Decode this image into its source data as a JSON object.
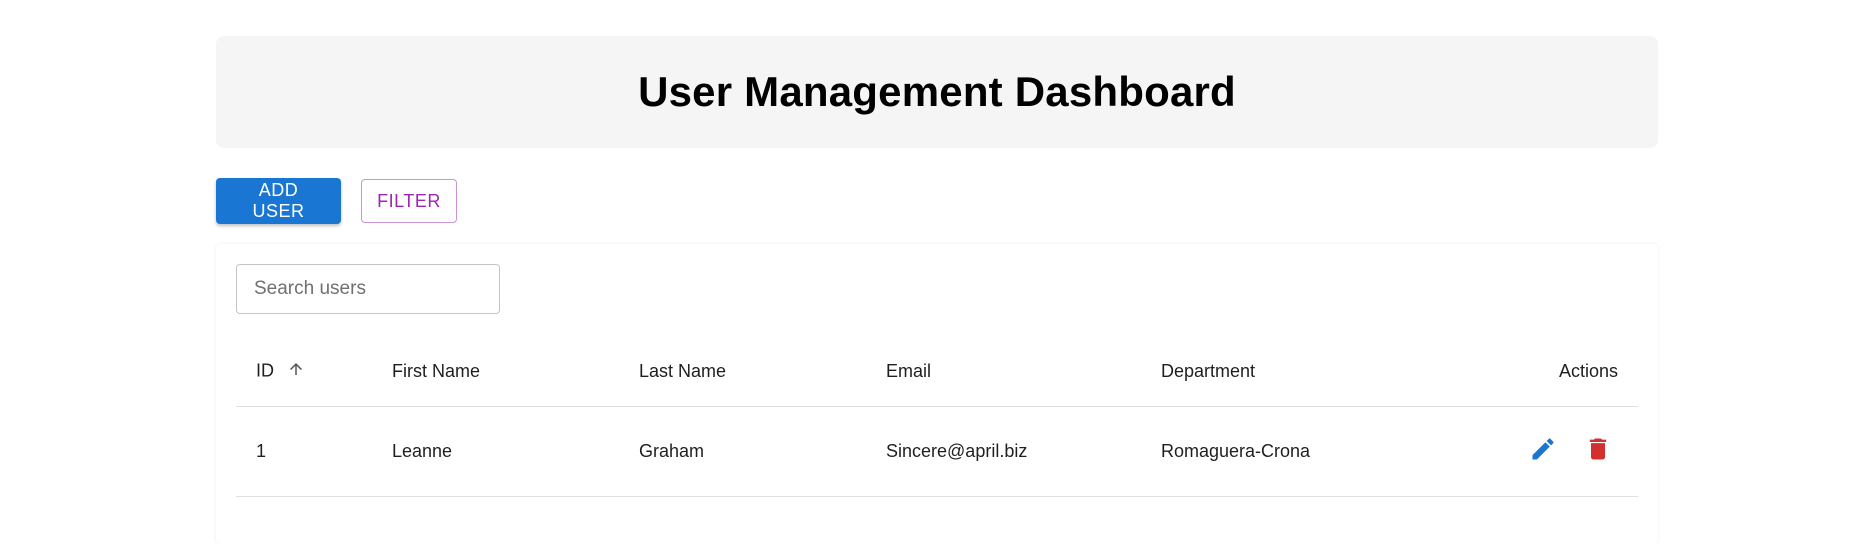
{
  "header": {
    "title": "User Management Dashboard"
  },
  "toolbar": {
    "add_user_label": "ADD USER",
    "filter_label": "FILTER"
  },
  "search": {
    "placeholder": "Search users",
    "value": ""
  },
  "table": {
    "columns": {
      "id": "ID",
      "first_name": "First Name",
      "last_name": "Last Name",
      "email": "Email",
      "department": "Department",
      "actions": "Actions"
    },
    "sort": {
      "column": "ID",
      "direction": "ascending",
      "icon": "arrow-up-icon"
    },
    "rows": [
      {
        "id": "1",
        "first_name": "Leanne",
        "last_name": "Graham",
        "email": "Sincere@april.biz",
        "department": "Romaguera-Crona"
      }
    ]
  },
  "icons": {
    "edit": "edit-pencil-icon",
    "delete": "trash-icon"
  },
  "colors": {
    "primary": "#1976d2",
    "secondary": "#9c27b0",
    "danger": "#d32f2f"
  }
}
